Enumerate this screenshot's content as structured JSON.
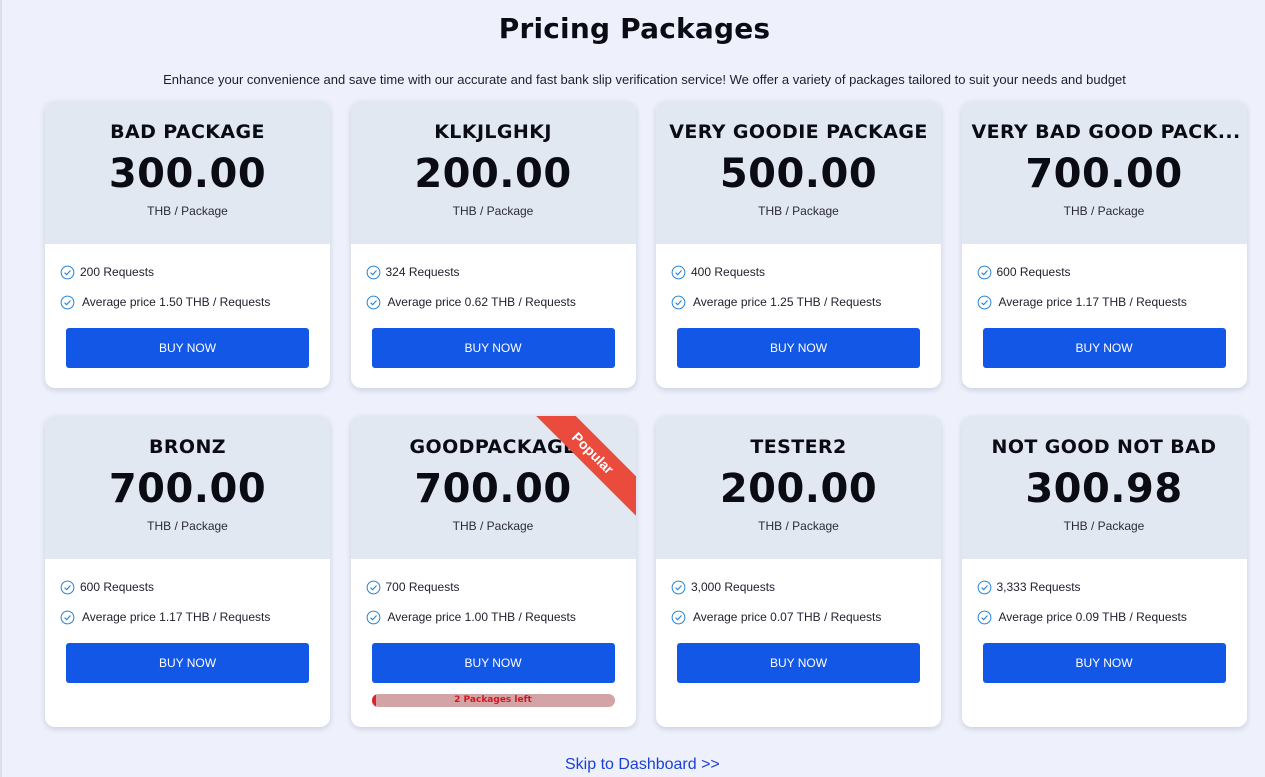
{
  "header": {
    "title": "Pricing Packages",
    "subtitle": "Enhance your convenience and save time with our accurate and fast bank slip verification service! We offer a variety of packages tailored to suit your needs and budget"
  },
  "colors": {
    "accent": "#1357e6",
    "card_head": "#e2e8f1",
    "ribbon": "#ea4b3d",
    "check": "#2b86d6"
  },
  "packages": [
    {
      "name": "BAD PACKAGE",
      "price": "300.00",
      "unit": "THB / Package",
      "requests": "200 Requests",
      "avg": "Average price 1.50 THB / Requests",
      "buy": "BUY NOW"
    },
    {
      "name": "KLKJLGHKJ",
      "price": "200.00",
      "unit": "THB / Package",
      "requests": "324 Requests",
      "avg": "Average price 0.62 THB / Requests",
      "buy": "BUY NOW"
    },
    {
      "name": "VERY GOODIE PACKAGE",
      "price": "500.00",
      "unit": "THB / Package",
      "requests": "400 Requests",
      "avg": "Average price 1.25 THB / Requests",
      "buy": "BUY NOW"
    },
    {
      "name": "VERY BAD GOOD PACK...",
      "price": "700.00",
      "unit": "THB / Package",
      "requests": "600 Requests",
      "avg": "Average price 1.17 THB / Requests",
      "buy": "BUY NOW"
    },
    {
      "name": "BRONZ",
      "price": "700.00",
      "unit": "THB / Package",
      "requests": "600 Requests",
      "avg": "Average price 1.17 THB / Requests",
      "buy": "BUY NOW"
    },
    {
      "name": "GOODPACKAGE",
      "price": "700.00",
      "unit": "THB / Package",
      "requests": "700 Requests",
      "avg": "Average price 1.00 THB / Requests",
      "buy": "BUY NOW",
      "ribbon": "Popular",
      "stock_text": "2 Packages left",
      "stock_fraction": 0.02
    },
    {
      "name": "TESTER2",
      "price": "200.00",
      "unit": "THB / Package",
      "requests": "3,000 Requests",
      "avg": "Average price 0.07 THB / Requests",
      "buy": "BUY NOW"
    },
    {
      "name": "NOT GOOD NOT BAD",
      "price": "300.98",
      "unit": "THB / Package",
      "requests": "3,333 Requests",
      "avg": "Average price 0.09 THB / Requests",
      "buy": "BUY NOW"
    }
  ],
  "footer": {
    "skip_link": "Skip to Dashboard >>"
  }
}
